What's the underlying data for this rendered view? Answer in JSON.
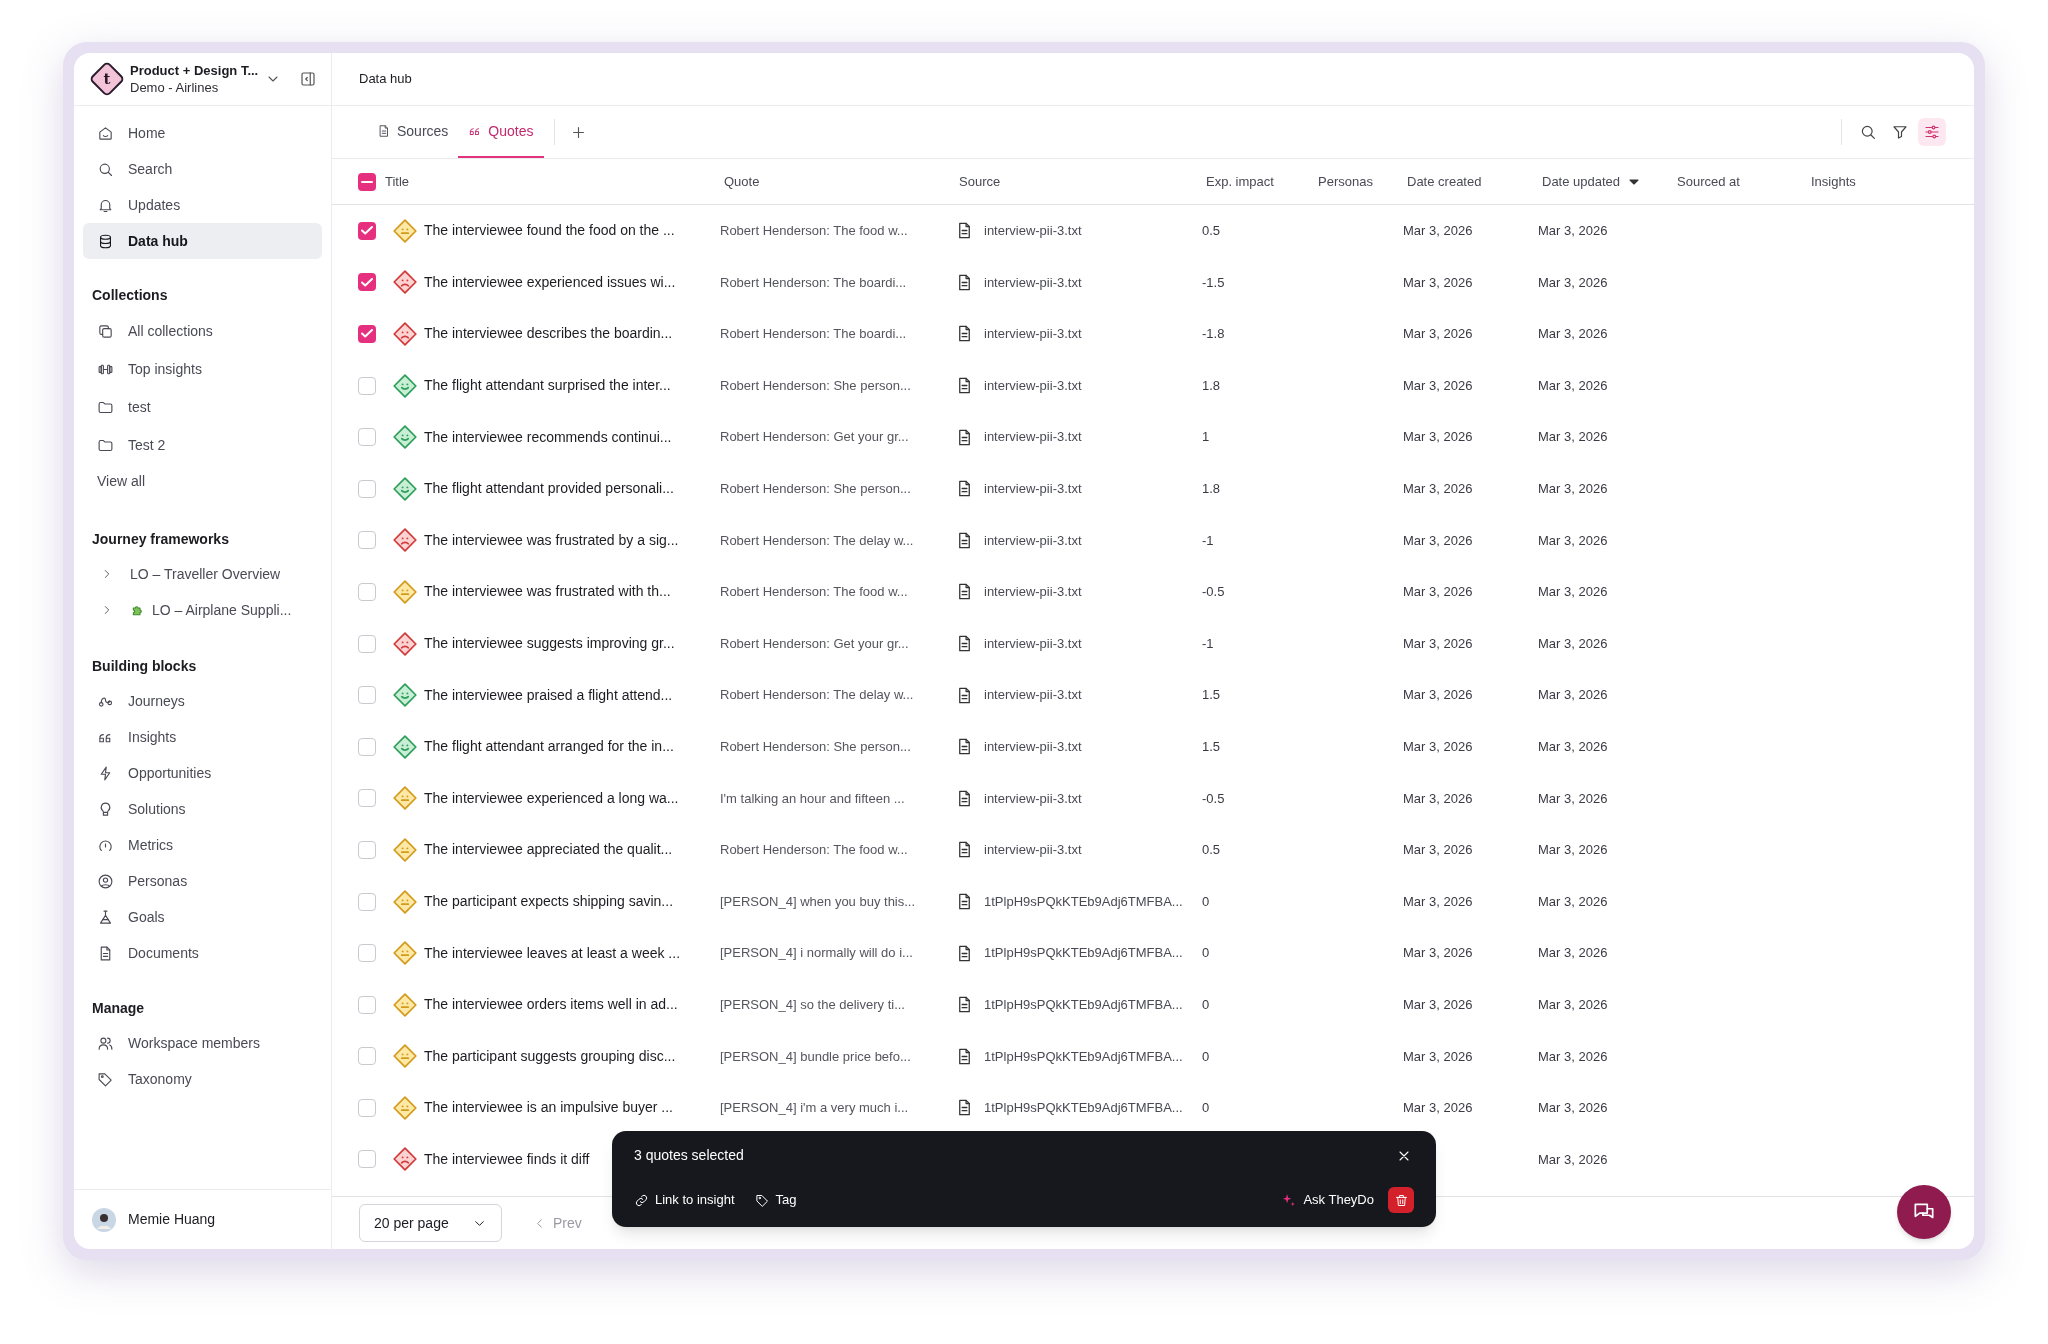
{
  "workspace": {
    "logo": "t",
    "name": "Product + Design T...",
    "subtitle": "Demo - Airlines"
  },
  "nav": [
    {
      "label": "Home",
      "selected": false
    },
    {
      "label": "Search",
      "selected": false
    },
    {
      "label": "Updates",
      "selected": false
    },
    {
      "label": "Data hub",
      "selected": true
    }
  ],
  "collections": {
    "heading": "Collections",
    "items": [
      "All collections",
      "Top insights",
      "test",
      "Test 2"
    ],
    "view_all": "View all"
  },
  "journey_frameworks": {
    "heading": "Journey frameworks",
    "items": [
      {
        "label": "LO – Traveller Overview",
        "expanded": false,
        "emoji": false
      },
      {
        "label": "LO – Airplane Suppli...",
        "expanded": false,
        "emoji": true
      }
    ]
  },
  "building_blocks": {
    "heading": "Building blocks",
    "items": [
      "Journeys",
      "Insights",
      "Opportunities",
      "Solutions",
      "Metrics",
      "Personas",
      "Goals",
      "Documents"
    ]
  },
  "manage": {
    "heading": "Manage",
    "items": [
      "Workspace members",
      "Taxonomy"
    ]
  },
  "user": {
    "name": "Memie Huang"
  },
  "page_title": "Data hub",
  "tabs": [
    {
      "label": "Sources",
      "selected": false
    },
    {
      "label": "Quotes",
      "selected": true
    }
  ],
  "toolbar_buttons": [
    {
      "kind": "search",
      "selected": false
    },
    {
      "kind": "filter",
      "selected": false
    },
    {
      "kind": "options",
      "selected": true
    }
  ],
  "table": {
    "select_all": {
      "indeterminate": true
    },
    "columns": [
      {
        "label": "Title",
        "sorted": false
      },
      {
        "label": "Quote",
        "sorted": false
      },
      {
        "label": "Source",
        "sorted": false
      },
      {
        "label": "Exp. impact",
        "sorted": false
      },
      {
        "label": "Personas",
        "sorted": false
      },
      {
        "label": "Date created",
        "sorted": false
      },
      {
        "label": "Date updated",
        "sorted": true
      },
      {
        "label": "Sourced at",
        "sorted": false
      },
      {
        "label": "Insights",
        "sorted": false
      }
    ],
    "rows": [
      {
        "checked": true,
        "kind": "neutral",
        "title": "The interviewee found the food on the ...",
        "quote": "Robert Henderson: The food w...",
        "source": "interview-pii-3.txt",
        "impact": "0.5",
        "date_created": "Mar 3, 2026",
        "date_updated": "Mar 3, 2026"
      },
      {
        "checked": true,
        "kind": "negative",
        "title": "The interviewee experienced issues wi...",
        "quote": "Robert Henderson: The boardi...",
        "source": "interview-pii-3.txt",
        "impact": "-1.5",
        "date_created": "Mar 3, 2026",
        "date_updated": "Mar 3, 2026"
      },
      {
        "checked": true,
        "kind": "negative",
        "title": "The interviewee describes the boardin...",
        "quote": "Robert Henderson: The boardi...",
        "source": "interview-pii-3.txt",
        "impact": "-1.8",
        "date_created": "Mar 3, 2026",
        "date_updated": "Mar 3, 2026"
      },
      {
        "checked": false,
        "kind": "positive",
        "title": "The flight attendant surprised the inter...",
        "quote": "Robert Henderson: She person...",
        "source": "interview-pii-3.txt",
        "impact": "1.8",
        "date_created": "Mar 3, 2026",
        "date_updated": "Mar 3, 2026"
      },
      {
        "checked": false,
        "kind": "positive",
        "title": "The interviewee recommends continui...",
        "quote": "Robert Henderson: Get your gr...",
        "source": "interview-pii-3.txt",
        "impact": "1",
        "date_created": "Mar 3, 2026",
        "date_updated": "Mar 3, 2026"
      },
      {
        "checked": false,
        "kind": "positive",
        "title": "The flight attendant provided personali...",
        "quote": "Robert Henderson: She person...",
        "source": "interview-pii-3.txt",
        "impact": "1.8",
        "date_created": "Mar 3, 2026",
        "date_updated": "Mar 3, 2026"
      },
      {
        "checked": false,
        "kind": "negative",
        "title": "The interviewee was frustrated by a sig...",
        "quote": "Robert Henderson: The delay w...",
        "source": "interview-pii-3.txt",
        "impact": "-1",
        "date_created": "Mar 3, 2026",
        "date_updated": "Mar 3, 2026"
      },
      {
        "checked": false,
        "kind": "neutral",
        "title": "The interviewee was frustrated with th...",
        "quote": "Robert Henderson: The food w...",
        "source": "interview-pii-3.txt",
        "impact": "-0.5",
        "date_created": "Mar 3, 2026",
        "date_updated": "Mar 3, 2026"
      },
      {
        "checked": false,
        "kind": "negative",
        "title": "The interviewee suggests improving gr...",
        "quote": "Robert Henderson: Get your gr...",
        "source": "interview-pii-3.txt",
        "impact": "-1",
        "date_created": "Mar 3, 2026",
        "date_updated": "Mar 3, 2026"
      },
      {
        "checked": false,
        "kind": "positive",
        "title": "The interviewee praised a flight attend...",
        "quote": "Robert Henderson: The delay w...",
        "source": "interview-pii-3.txt",
        "impact": "1.5",
        "date_created": "Mar 3, 2026",
        "date_updated": "Mar 3, 2026"
      },
      {
        "checked": false,
        "kind": "positive",
        "title": "The flight attendant arranged for the in...",
        "quote": "Robert Henderson: She person...",
        "source": "interview-pii-3.txt",
        "impact": "1.5",
        "date_created": "Mar 3, 2026",
        "date_updated": "Mar 3, 2026"
      },
      {
        "checked": false,
        "kind": "neutral",
        "title": "The interviewee experienced a long wa...",
        "quote": "I'm talking an hour and fifteen ...",
        "source": "interview-pii-3.txt",
        "impact": "-0.5",
        "date_created": "Mar 3, 2026",
        "date_updated": "Mar 3, 2026"
      },
      {
        "checked": false,
        "kind": "neutral",
        "title": "The interviewee appreciated the qualit...",
        "quote": "Robert Henderson: The food w...",
        "source": "interview-pii-3.txt",
        "impact": "0.5",
        "date_created": "Mar 3, 2026",
        "date_updated": "Mar 3, 2026"
      },
      {
        "checked": false,
        "kind": "neutral",
        "title": "The participant expects shipping savin...",
        "quote": "[PERSON_4] when you buy this...",
        "source": "1tPlpH9sPQkKTEb9Adj6TMFBA...",
        "impact": "0",
        "date_created": "Mar 3, 2026",
        "date_updated": "Mar 3, 2026"
      },
      {
        "checked": false,
        "kind": "neutral",
        "title": "The interviewee leaves at least a week ...",
        "quote": "[PERSON_4] i normally will do i...",
        "source": "1tPlpH9sPQkKTEb9Adj6TMFBA...",
        "impact": "0",
        "date_created": "Mar 3, 2026",
        "date_updated": "Mar 3, 2026"
      },
      {
        "checked": false,
        "kind": "neutral",
        "title": "The interviewee orders items well in ad...",
        "quote": "[PERSON_4] so the delivery ti...",
        "source": "1tPlpH9sPQkKTEb9Adj6TMFBA...",
        "impact": "0",
        "date_created": "Mar 3, 2026",
        "date_updated": "Mar 3, 2026"
      },
      {
        "checked": false,
        "kind": "neutral",
        "title": "The participant suggests grouping disc...",
        "quote": "[PERSON_4] bundle price befo...",
        "source": "1tPlpH9sPQkKTEb9Adj6TMFBA...",
        "impact": "0",
        "date_created": "Mar 3, 2026",
        "date_updated": "Mar 3, 2026"
      },
      {
        "checked": false,
        "kind": "neutral",
        "title": "The interviewee is an impulsive buyer ...",
        "quote": "[PERSON_4] i'm a very much i...",
        "source": "1tPlpH9sPQkKTEb9Adj6TMFBA...",
        "impact": "0",
        "date_created": "Mar 3, 2026",
        "date_updated": "Mar 3, 2026"
      },
      {
        "checked": false,
        "kind": "negative",
        "title": "The interviewee finds it diff",
        "date_updated": "Mar 3, 2026"
      }
    ]
  },
  "pagination": {
    "per_page": "20 per page",
    "prev": "Prev"
  },
  "selection_bar": {
    "title": "3 quotes selected",
    "actions": [
      {
        "kind": "link",
        "label": "Link to insight"
      },
      {
        "kind": "tag",
        "label": "Tag"
      }
    ],
    "ask": "Ask TheyDo"
  }
}
